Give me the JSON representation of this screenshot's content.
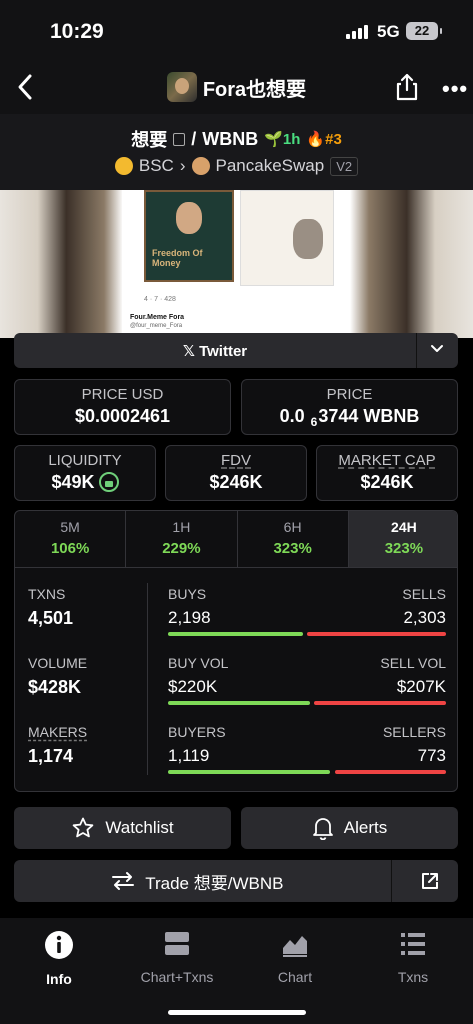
{
  "status": {
    "time": "10:29",
    "network": "5G",
    "battery": "22"
  },
  "nav": {
    "title": "Fora也想要"
  },
  "pair": {
    "base": "想要",
    "separator": "/",
    "quote": "WBNB",
    "age": "1h",
    "rank": "#3",
    "chain": "BSC",
    "dex": "PancakeSwap",
    "version": "V2"
  },
  "banner": {
    "book_title": "Freedom Of Money",
    "tweet_meta": "4  ·  7  ·  428",
    "tweet_author": "Four.Meme Fora",
    "tweet_handle": "@four_meme_Fora"
  },
  "twitter": {
    "label": "Twitter",
    "glyph": "𝕏"
  },
  "stats": {
    "price_usd": {
      "label": "PRICE USD",
      "value": "$0.0002461"
    },
    "price": {
      "label": "PRICE",
      "value_pre": "0.0",
      "value_sub": "6",
      "value_post": "3744 WBNB"
    },
    "liquidity": {
      "label": "LIQUIDITY",
      "value": "$49K"
    },
    "fdv": {
      "label": "FDV",
      "value": "$246K"
    },
    "market_cap": {
      "label": "MARKET CAP",
      "value": "$246K"
    }
  },
  "timeframes": [
    {
      "label": "5M",
      "value": "106%"
    },
    {
      "label": "1H",
      "value": "229%"
    },
    {
      "label": "6H",
      "value": "323%"
    },
    {
      "label": "24H",
      "value": "323%",
      "active": true
    }
  ],
  "activity": {
    "txns": {
      "label": "TXNS",
      "value": "4,501"
    },
    "volume": {
      "label": "VOLUME",
      "value": "$428K"
    },
    "makers": {
      "label": "MAKERS",
      "value": "1,174"
    },
    "buys": {
      "label": "BUYS",
      "value": "2,198"
    },
    "sells": {
      "label": "SELLS",
      "value": "2,303"
    },
    "buy_vol": {
      "label": "BUY VOL",
      "value": "$220K"
    },
    "sell_vol": {
      "label": "SELL VOL",
      "value": "$207K"
    },
    "buyers": {
      "label": "BUYERS",
      "value": "1,119"
    },
    "sellers": {
      "label": "SELLERS",
      "value": "773"
    }
  },
  "buttons": {
    "watchlist": "Watchlist",
    "alerts": "Alerts",
    "trade": "Trade 想要/WBNB"
  },
  "tabbar": [
    {
      "label": "Info",
      "icon": "info-icon",
      "active": true
    },
    {
      "label": "Chart+Txns",
      "icon": "chart-txns-icon"
    },
    {
      "label": "Chart",
      "icon": "chart-icon"
    },
    {
      "label": "Txns",
      "icon": "list-icon"
    }
  ],
  "colors": {
    "buy": "#7ed957",
    "sell": "#ef4444",
    "background": "#000000"
  }
}
